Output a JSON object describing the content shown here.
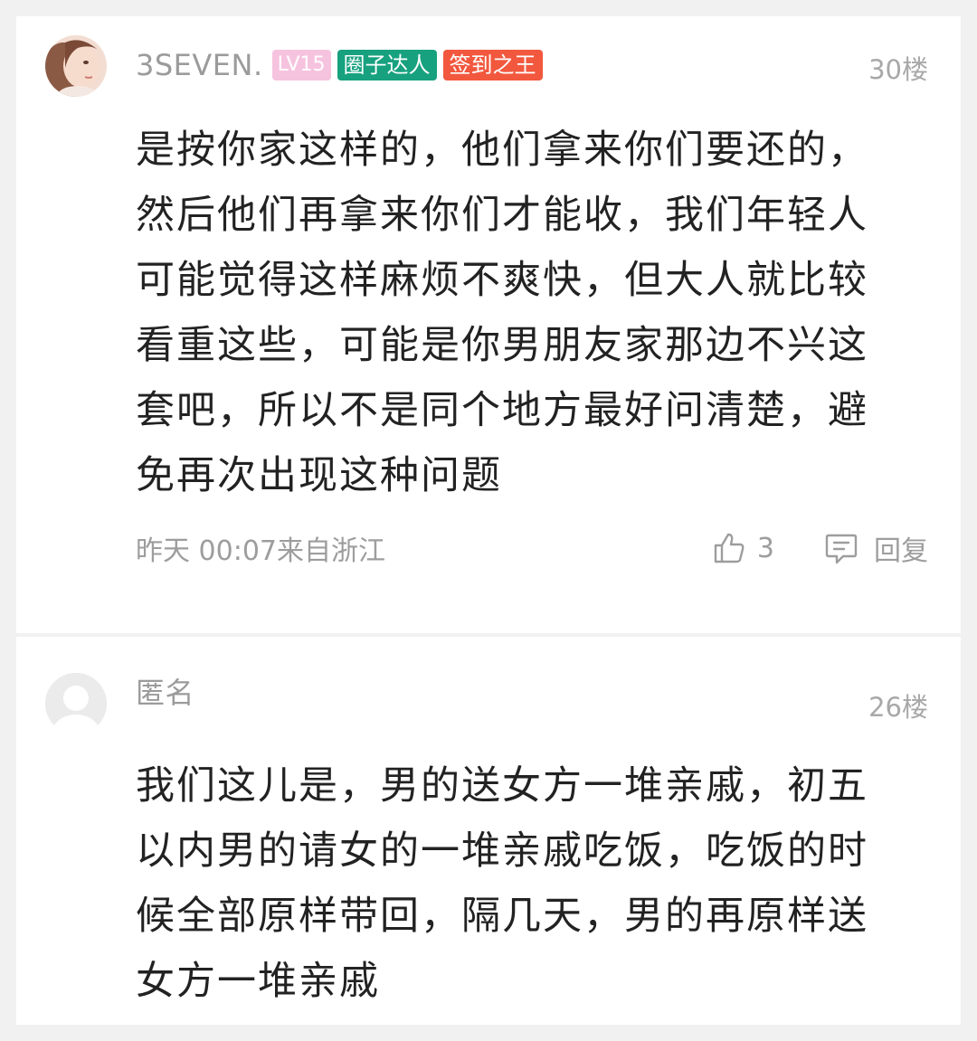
{
  "comments": [
    {
      "username": "3SEVEN.",
      "level": "LV15",
      "badges": [
        "圈子达人",
        "签到之王"
      ],
      "floor": "30楼",
      "content": "是按你家这样的，他们拿来你们要还的，然后他们再拿来你们才能收，我们年轻人可能觉得这样麻烦不爽快，但大人就比较看重这些，可能是你男朋友家那边不兴这套吧，所以不是同个地方最好问清楚，避免再次出现这种问题",
      "time": "昨天 00:07",
      "location": "来自浙江",
      "likes": "3",
      "reply_label": "回复"
    },
    {
      "username": "匿名",
      "floor": "26楼",
      "content": "我们这儿是，男的送女方一堆亲戚，初五以内男的请女的一堆亲戚吃饭，吃饭的时候全部原样带回，隔几天，男的再原样送女方一堆亲戚"
    }
  ],
  "icons": {
    "like": "thumbs-up-icon",
    "reply": "chat-bubble-icon"
  },
  "colors": {
    "badge_level": "#f6c3df",
    "badge_green": "#17a17f",
    "badge_red": "#f2583e",
    "text": "#222222",
    "muted": "#9d9d9d"
  }
}
